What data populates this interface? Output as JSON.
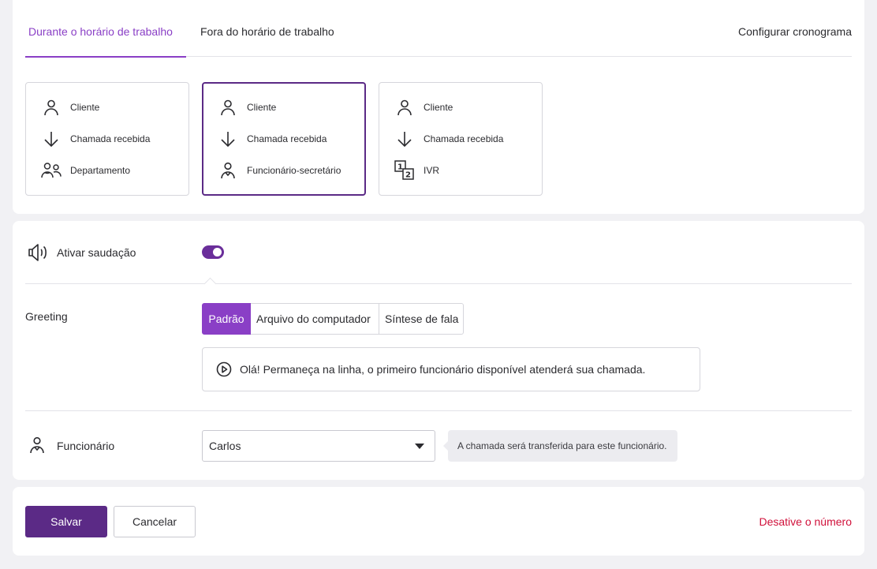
{
  "tabs": {
    "during": "Durante o horário de trabalho",
    "outside": "Fora do horário de trabalho",
    "schedule": "Configurar cronograma"
  },
  "flows": [
    {
      "selected": false,
      "rows": [
        {
          "icon": "person-icon",
          "label": "Cliente"
        },
        {
          "icon": "arrow-down-icon",
          "label": "Chamada recebida"
        },
        {
          "icon": "group-icon",
          "label": "Departamento"
        }
      ]
    },
    {
      "selected": true,
      "rows": [
        {
          "icon": "person-icon",
          "label": "Cliente"
        },
        {
          "icon": "arrow-down-icon",
          "label": "Chamada recebida"
        },
        {
          "icon": "employee-icon",
          "label": "Funcionário-secretário"
        }
      ]
    },
    {
      "selected": false,
      "rows": [
        {
          "icon": "person-icon",
          "label": "Cliente"
        },
        {
          "icon": "arrow-down-icon",
          "label": "Chamada recebida"
        },
        {
          "icon": "ivr-icon",
          "label": "IVR"
        }
      ]
    }
  ],
  "greeting": {
    "toggle_label": "Ativar saudação",
    "toggle_on": true,
    "label": "Greeting",
    "sources": [
      "Padrão",
      "Arquivo do computador",
      "Síntese de fala"
    ],
    "active_source": "Padrão",
    "text": "Olá! Permaneça na linha, o primeiro funcionário disponível atenderá sua chamada."
  },
  "employee": {
    "label": "Funcionário",
    "value": "Carlos",
    "hint": "A chamada será transferida para este funcionário."
  },
  "actions": {
    "save": "Salvar",
    "cancel": "Cancelar",
    "deactivate": "Desative o número"
  },
  "colors": {
    "accent": "#8a3fc6",
    "primary": "#5b2a86",
    "danger": "#d0103a"
  }
}
